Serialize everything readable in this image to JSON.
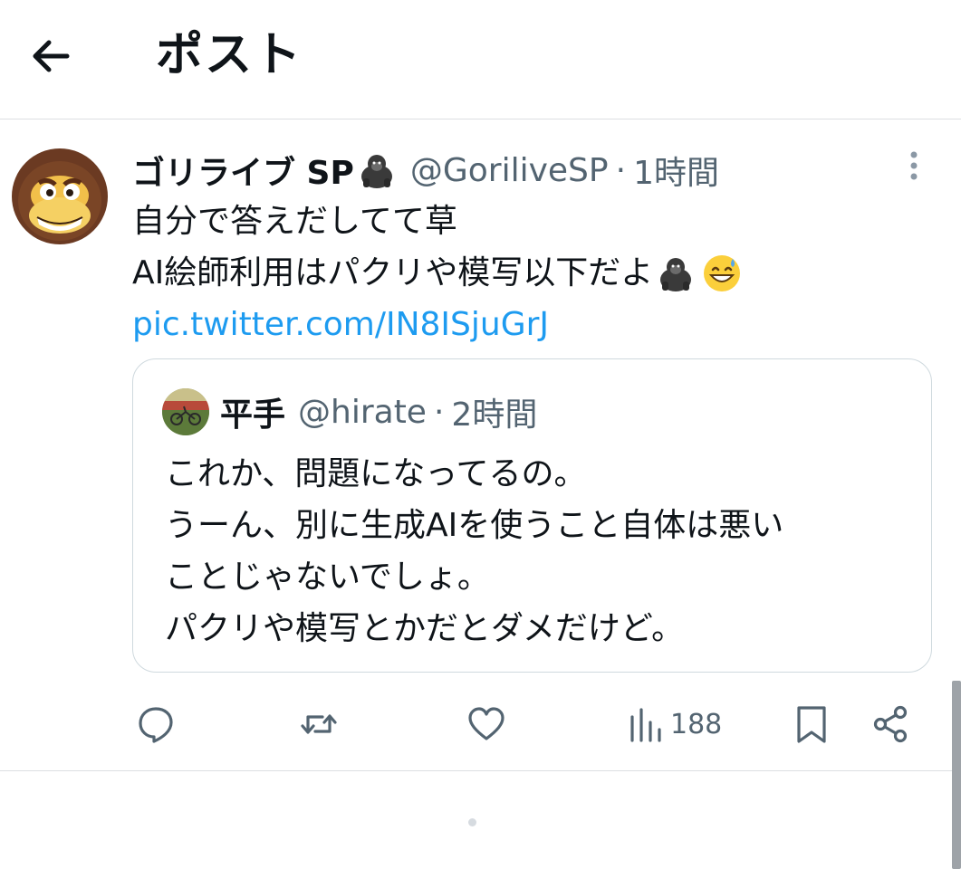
{
  "header": {
    "title": "ポスト",
    "back_icon": "arrow-left-icon"
  },
  "tweet": {
    "display_name": "ゴリライブ SP",
    "name_emoji": "gorilla-emoji",
    "handle": "@GoriliveSP",
    "separator": "·",
    "time": "1時間",
    "text_line1": "自分で答えだしてて草",
    "text_line2": "AI絵師利用はパクリや模写以下だよ",
    "line2_emojis": [
      "gorilla-emoji",
      "grinning-sweat-emoji"
    ],
    "link": "pic.twitter.com/IN8ISjuGrJ"
  },
  "quote": {
    "display_name": "平手",
    "handle": "@hirate",
    "separator": "·",
    "time": "2時間",
    "lines": [
      "これか、問題になってるの。",
      "うーん、別に生成AIを使うこと自体は悪い",
      "ことじゃないでしょ。",
      "パクリや模写とかだとダメだけど。"
    ]
  },
  "actions": {
    "reply_icon": "reply-icon",
    "retweet_icon": "retweet-icon",
    "like_icon": "heart-icon",
    "views_icon": "views-icon",
    "views_count": "188",
    "bookmark_icon": "bookmark-icon",
    "share_icon": "share-icon"
  },
  "colors": {
    "link": "#1d9bf0",
    "secondary_text": "#536471",
    "primary_text": "#0f1419",
    "border": "#cfd9de"
  }
}
